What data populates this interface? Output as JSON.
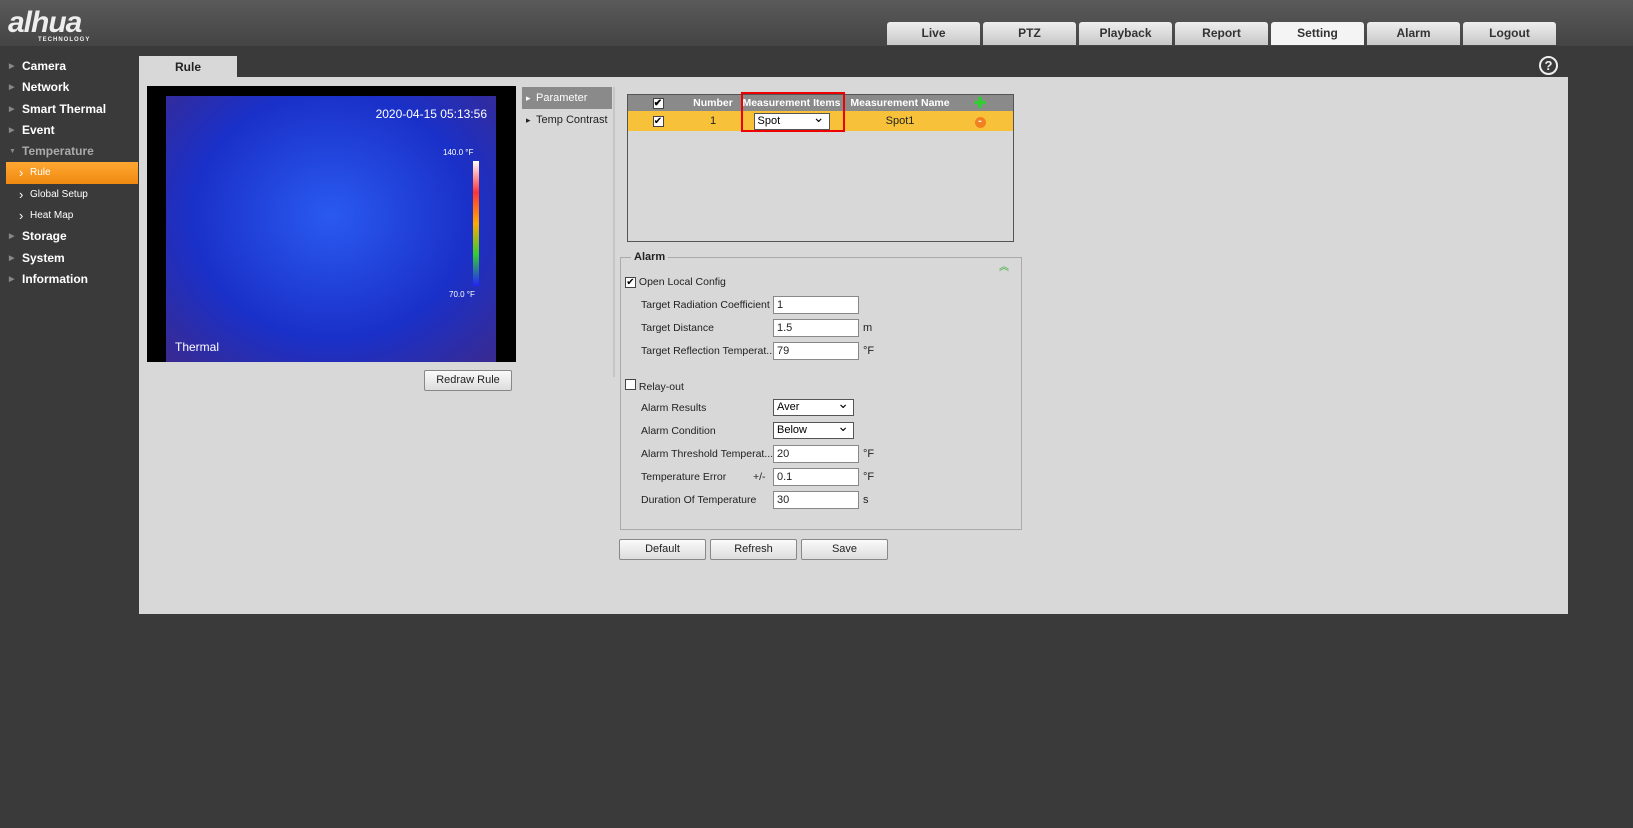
{
  "brand": {
    "logo": "alhua",
    "sub": "TECHNOLOGY"
  },
  "tabs": [
    "Live",
    "PTZ",
    "Playback",
    "Report",
    "Setting",
    "Alarm",
    "Logout"
  ],
  "sidebar": {
    "camera": "Camera",
    "network": "Network",
    "smart_thermal": "Smart Thermal",
    "event": "Event",
    "temperature": "Temperature",
    "rule": "Rule",
    "global_setup": "Global Setup",
    "heat_map": "Heat Map",
    "storage": "Storage",
    "system": "System",
    "information": "Information"
  },
  "page_tab": "Rule",
  "help": "?",
  "video": {
    "timestamp": "2020-04-15 05:13:56",
    "label": "Thermal",
    "scale_high": "140.0 °F",
    "scale_low": "70.0 °F"
  },
  "redraw": "Redraw Rule",
  "subnav": [
    "Parameter",
    "Temp Contrast"
  ],
  "table": {
    "headers": [
      "Number",
      "Measurement Items",
      "Measurement Name"
    ],
    "rows": [
      {
        "number": "1",
        "item": "Spot",
        "name": "Spot1"
      }
    ]
  },
  "alarm": {
    "title": "Alarm",
    "open_local": "Open Local Config",
    "fields": [
      {
        "label": "Target Radiation Coefficient",
        "value": "1",
        "unit": ""
      },
      {
        "label": "Target Distance",
        "value": "1.5",
        "unit": "m"
      },
      {
        "label": "Target Reflection Temperat...",
        "value": "79",
        "unit": "°F"
      }
    ],
    "relay": "Relay-out",
    "results_label": "Alarm Results",
    "results": "Aver",
    "condition_label": "Alarm Condition",
    "condition": "Below",
    "threshold_label": "Alarm Threshold Temperat...",
    "threshold": "20",
    "threshold_unit": "°F",
    "error_label": "Temperature Error",
    "error_pm": "+/-",
    "error": "0.1",
    "error_unit": "°F",
    "duration_label": "Duration Of Temperature",
    "duration": "30",
    "duration_unit": "s"
  },
  "buttons": {
    "default": "Default",
    "refresh": "Refresh",
    "save": "Save"
  }
}
